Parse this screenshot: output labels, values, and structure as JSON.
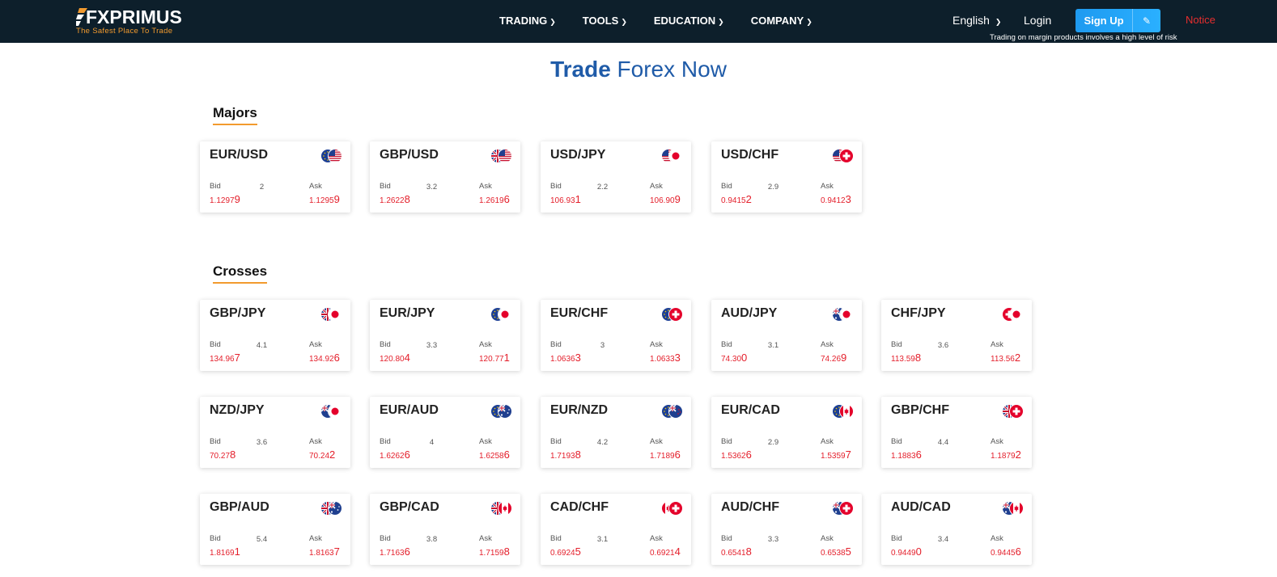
{
  "header": {
    "logo_text": "FXPRIMUS",
    "logo_tagline": "The Safest Place To Trade",
    "nav": [
      "TRADING",
      "TOOLS",
      "EDUCATION",
      "COMPANY"
    ],
    "language": "English",
    "login": "Login",
    "signup": "Sign Up",
    "notice": "Notice",
    "risk_warning": "Trading on margin products involves a high level of risk"
  },
  "page": {
    "title_bold": "Trade",
    "title_rest": "Forex Now",
    "bid_label": "Bid",
    "ask_label": "Ask"
  },
  "sections": [
    {
      "title": "Majors",
      "pairs": [
        {
          "name": "EUR/USD",
          "spread": "2",
          "bid_prefix": "1.1297",
          "bid_last": "9",
          "ask_prefix": "1.1295",
          "ask_last": "9",
          "flags": [
            "eu",
            "us"
          ]
        },
        {
          "name": "GBP/USD",
          "spread": "3.2",
          "bid_prefix": "1.2622",
          "bid_last": "8",
          "ask_prefix": "1.2619",
          "ask_last": "6",
          "flags": [
            "gb",
            "us"
          ]
        },
        {
          "name": "USD/JPY",
          "spread": "2.2",
          "bid_prefix": "106.93",
          "bid_last": "1",
          "ask_prefix": "106.90",
          "ask_last": "9",
          "flags": [
            "us",
            "jp"
          ]
        },
        {
          "name": "USD/CHF",
          "spread": "2.9",
          "bid_prefix": "0.9415",
          "bid_last": "2",
          "ask_prefix": "0.9412",
          "ask_last": "3",
          "flags": [
            "us",
            "ch"
          ]
        }
      ]
    },
    {
      "title": "Crosses",
      "pairs": [
        {
          "name": "GBP/JPY",
          "spread": "4.1",
          "bid_prefix": "134.96",
          "bid_last": "7",
          "ask_prefix": "134.92",
          "ask_last": "6",
          "flags": [
            "gb",
            "jp"
          ]
        },
        {
          "name": "EUR/JPY",
          "spread": "3.3",
          "bid_prefix": "120.80",
          "bid_last": "4",
          "ask_prefix": "120.77",
          "ask_last": "1",
          "flags": [
            "eu",
            "jp"
          ]
        },
        {
          "name": "EUR/CHF",
          "spread": "3",
          "bid_prefix": "1.0636",
          "bid_last": "3",
          "ask_prefix": "1.0633",
          "ask_last": "3",
          "flags": [
            "eu",
            "ch"
          ]
        },
        {
          "name": "AUD/JPY",
          "spread": "3.1",
          "bid_prefix": "74.30",
          "bid_last": "0",
          "ask_prefix": "74.26",
          "ask_last": "9",
          "flags": [
            "au",
            "jp"
          ]
        },
        {
          "name": "CHF/JPY",
          "spread": "3.6",
          "bid_prefix": "113.59",
          "bid_last": "8",
          "ask_prefix": "113.56",
          "ask_last": "2",
          "flags": [
            "ch",
            "jp"
          ]
        },
        {
          "name": "NZD/JPY",
          "spread": "3.6",
          "bid_prefix": "70.27",
          "bid_last": "8",
          "ask_prefix": "70.24",
          "ask_last": "2",
          "flags": [
            "nz",
            "jp"
          ]
        },
        {
          "name": "EUR/AUD",
          "spread": "4",
          "bid_prefix": "1.6262",
          "bid_last": "6",
          "ask_prefix": "1.6258",
          "ask_last": "6",
          "flags": [
            "eu",
            "au"
          ]
        },
        {
          "name": "EUR/NZD",
          "spread": "4.2",
          "bid_prefix": "1.7193",
          "bid_last": "8",
          "ask_prefix": "1.7189",
          "ask_last": "6",
          "flags": [
            "eu",
            "nz"
          ]
        },
        {
          "name": "EUR/CAD",
          "spread": "2.9",
          "bid_prefix": "1.5362",
          "bid_last": "6",
          "ask_prefix": "1.5359",
          "ask_last": "7",
          "flags": [
            "eu",
            "ca"
          ]
        },
        {
          "name": "GBP/CHF",
          "spread": "4.4",
          "bid_prefix": "1.1883",
          "bid_last": "6",
          "ask_prefix": "1.1879",
          "ask_last": "2",
          "flags": [
            "gb",
            "ch"
          ]
        },
        {
          "name": "GBP/AUD",
          "spread": "5.4",
          "bid_prefix": "1.8169",
          "bid_last": "1",
          "ask_prefix": "1.8163",
          "ask_last": "7",
          "flags": [
            "gb",
            "au"
          ]
        },
        {
          "name": "GBP/CAD",
          "spread": "3.8",
          "bid_prefix": "1.7163",
          "bid_last": "6",
          "ask_prefix": "1.7159",
          "ask_last": "8",
          "flags": [
            "gb",
            "ca"
          ]
        },
        {
          "name": "CAD/CHF",
          "spread": "3.1",
          "bid_prefix": "0.6924",
          "bid_last": "5",
          "ask_prefix": "0.6921",
          "ask_last": "4",
          "flags": [
            "ca",
            "ch"
          ]
        },
        {
          "name": "AUD/CHF",
          "spread": "3.3",
          "bid_prefix": "0.6541",
          "bid_last": "8",
          "ask_prefix": "0.6538",
          "ask_last": "5",
          "flags": [
            "au",
            "ch"
          ]
        },
        {
          "name": "AUD/CAD",
          "spread": "3.4",
          "bid_prefix": "0.9449",
          "bid_last": "0",
          "ask_prefix": "0.9445",
          "ask_last": "6",
          "flags": [
            "au",
            "ca"
          ]
        }
      ]
    }
  ],
  "colors": {
    "header_bg": "#0d1f2b",
    "accent_orange": "#f29a2e",
    "title_blue": "#1f5ba8",
    "price_red": "#e4202c",
    "signup_blue": "#1e9af0"
  }
}
